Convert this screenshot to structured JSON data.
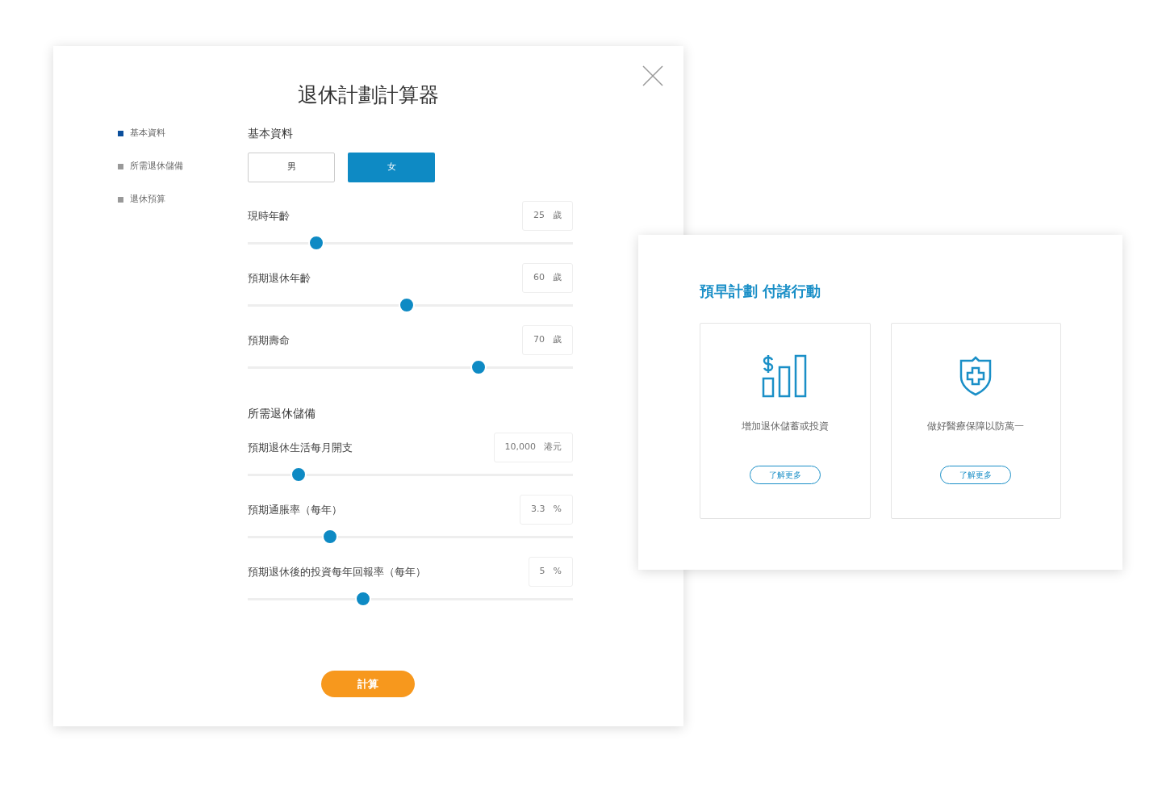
{
  "calculator": {
    "title": "退休計劃計算器",
    "sidebar": [
      {
        "label": "基本資料",
        "selected": true
      },
      {
        "label": "所需退休儲備",
        "selected": false
      },
      {
        "label": "退休預算",
        "selected": false
      }
    ],
    "sections": [
      {
        "heading": "基本資料",
        "gender": [
          {
            "label": "男",
            "selected": false
          },
          {
            "label": "女",
            "selected": true
          }
        ],
        "sliders": [
          {
            "label": "現時年齡",
            "value": "25",
            "unit": "歲",
            "level": 0.21
          },
          {
            "label": "預期退休年齡",
            "value": "60",
            "unit": "歲",
            "level": 0.49
          },
          {
            "label": "預期壽命",
            "value": "70",
            "unit": "歲",
            "level": 0.71
          }
        ]
      },
      {
        "heading": "所需退休儲備",
        "sliders": [
          {
            "label": "預期退休生活每月開支",
            "value": "10,000",
            "unit": "港元",
            "level": 0.156
          },
          {
            "label": "預期通脹率（每年）",
            "value": "3.3",
            "unit": "%",
            "level": 0.253
          },
          {
            "label": "預期退休後的投資每年回報率（每年）",
            "value": "5",
            "unit": "%",
            "level": 0.355
          }
        ]
      }
    ],
    "calculate_button": "計算"
  },
  "advice": {
    "heading": "預早計劃 付諸行動",
    "cards": [
      {
        "kind": "savings",
        "text": "增加退休儲蓄或投資",
        "button": "了解更多"
      },
      {
        "kind": "medical",
        "text": "做好醫療保障以防萬一",
        "button": "了解更多"
      }
    ]
  }
}
